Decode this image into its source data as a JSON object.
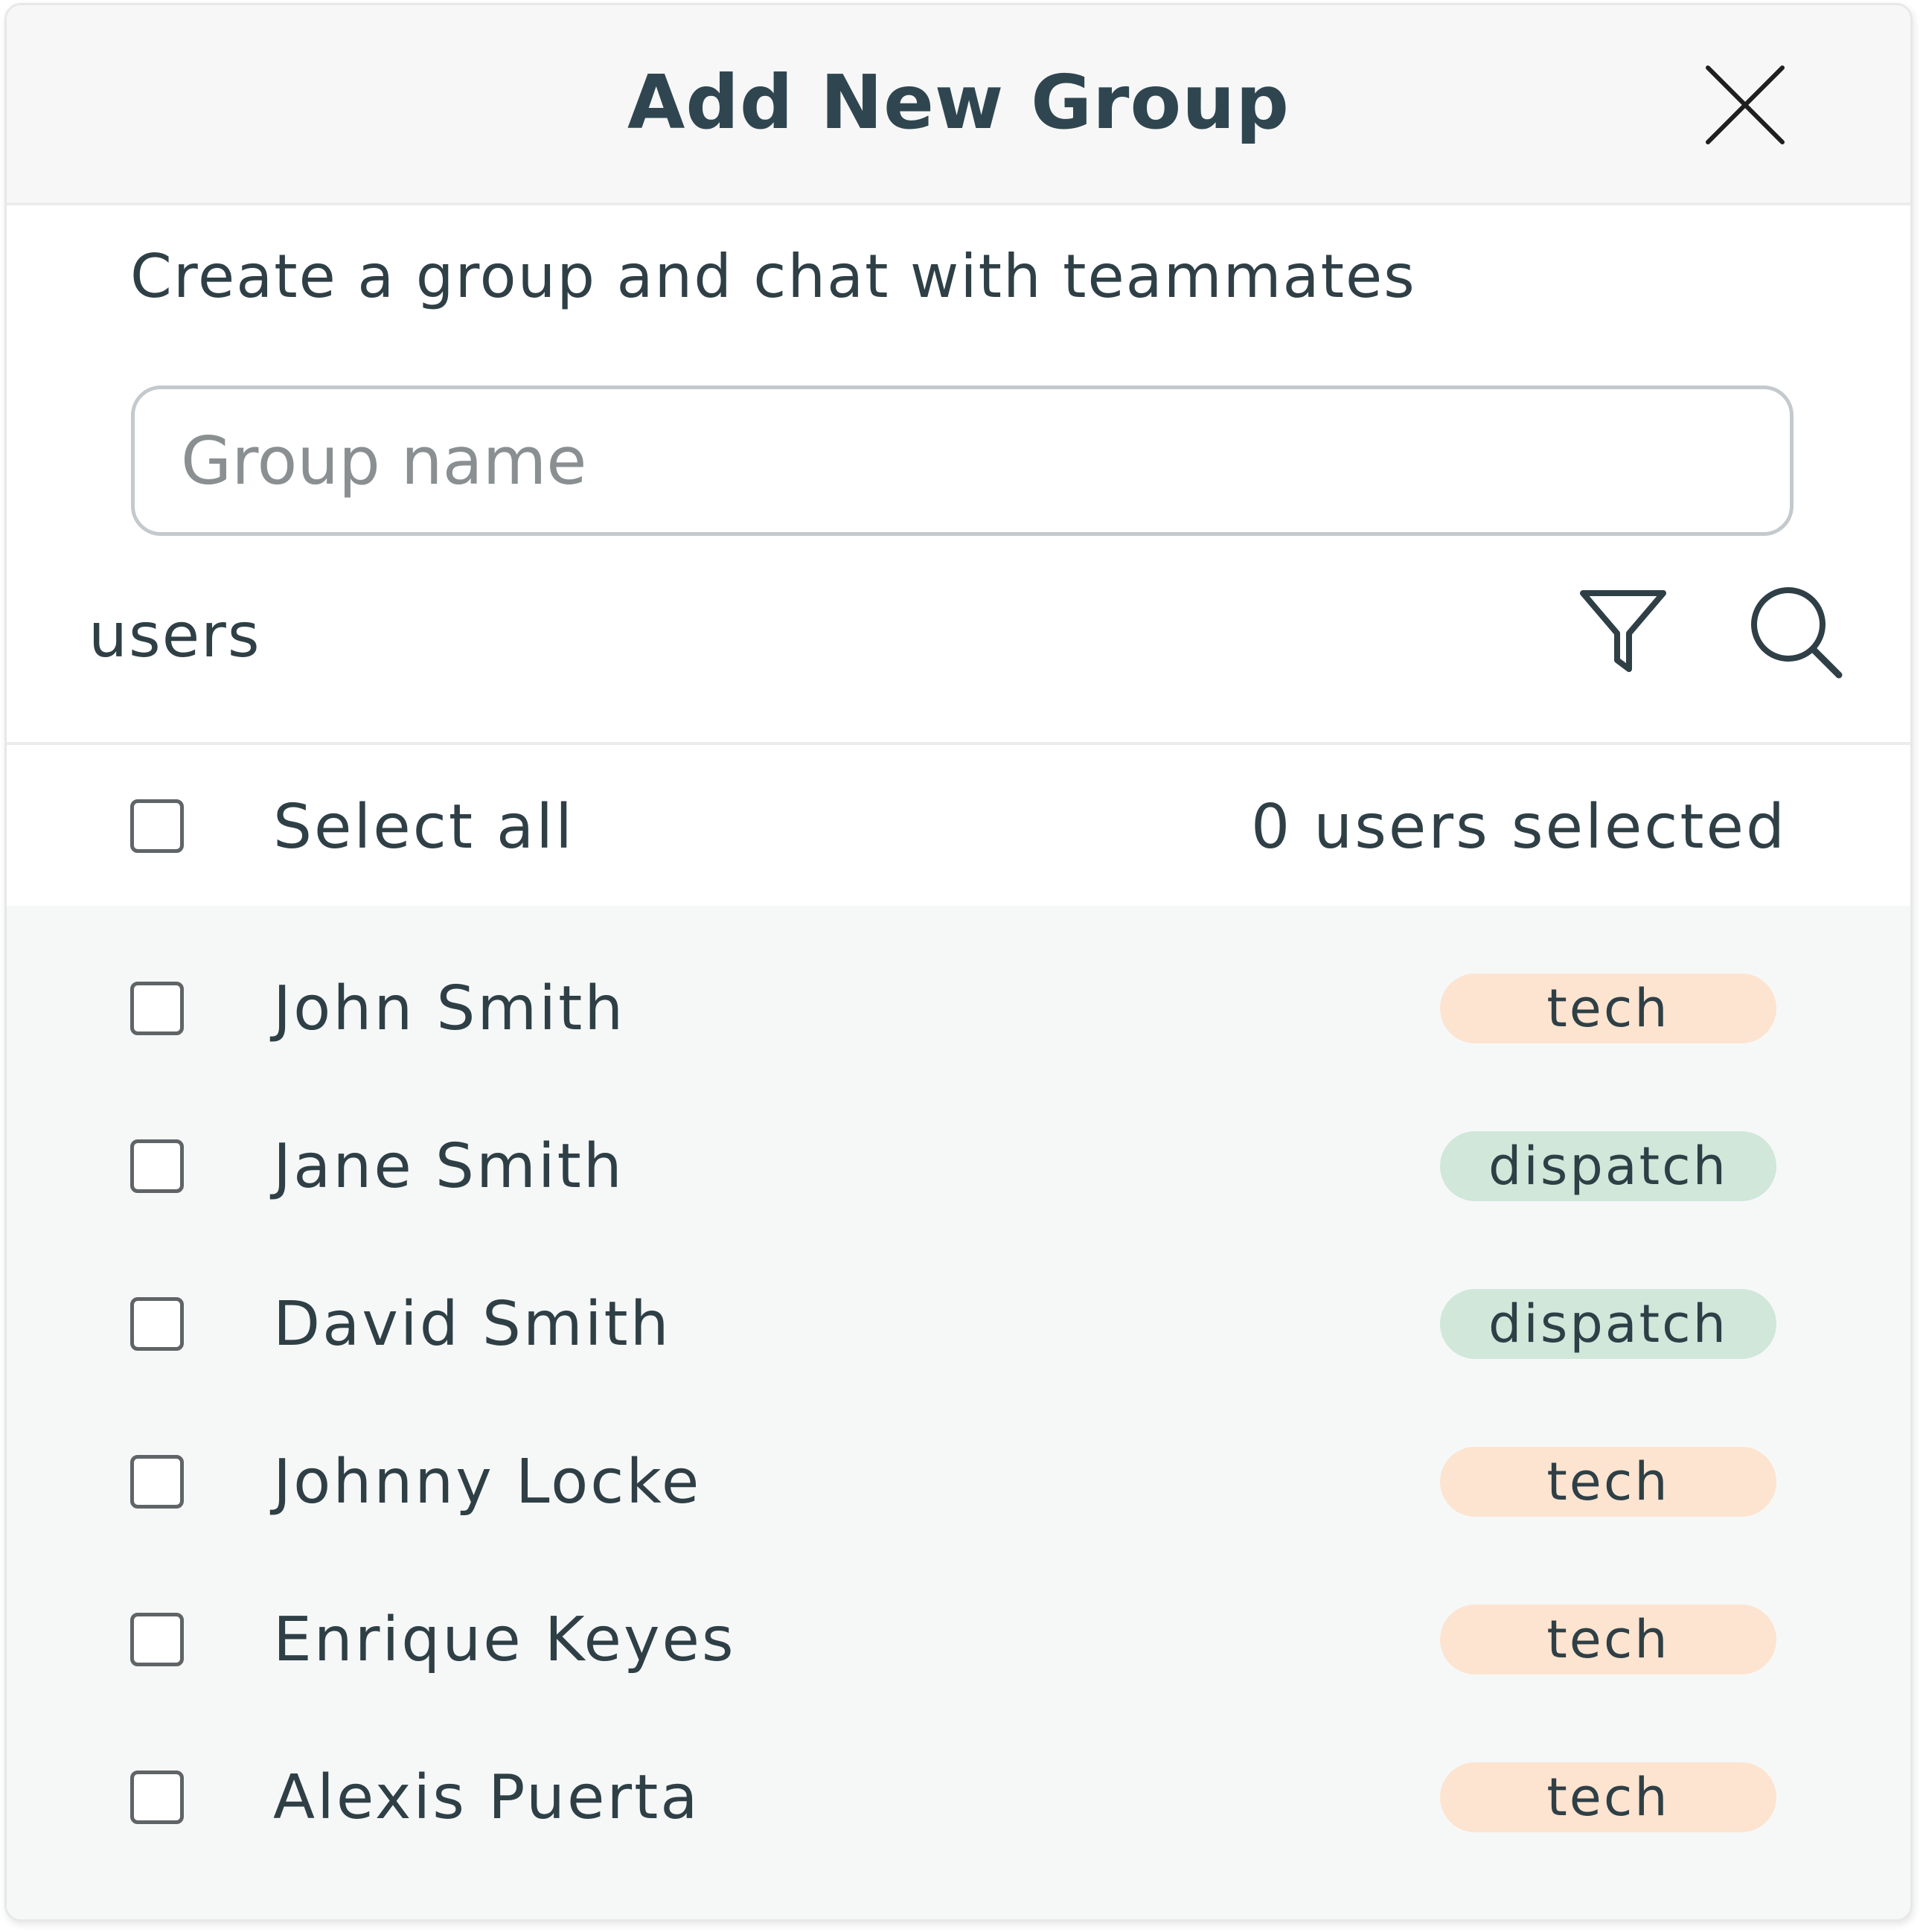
{
  "modal": {
    "title": "Add New Group",
    "subtitle": "Create a group and chat with teammates"
  },
  "group_name": {
    "value": "",
    "placeholder": "Group name"
  },
  "users_section": {
    "label": "users",
    "filter_icon": "filter-funnel-icon",
    "search_icon": "search-magnifier-icon"
  },
  "select_all": {
    "label": "Select all",
    "checked": false,
    "selected_count": "0 users selected"
  },
  "users": [
    {
      "name": "John Smith",
      "role": "tech",
      "checked": false
    },
    {
      "name": "Jane Smith",
      "role": "dispatch",
      "checked": false
    },
    {
      "name": "David Smith",
      "role": "dispatch",
      "checked": false
    },
    {
      "name": "Johnny Locke",
      "role": "tech",
      "checked": false
    },
    {
      "name": "Enrique Keyes",
      "role": "tech",
      "checked": false
    },
    {
      "name": "Alexis Puerta",
      "role": "tech",
      "checked": false
    }
  ],
  "colors": {
    "title": "#2f4650",
    "text": "#2f3f46",
    "header_bg": "#f7f7f7",
    "list_bg": "#f6f8f8",
    "tech_badge": "#fde4d0",
    "dispatch_badge": "#d0e7da"
  }
}
